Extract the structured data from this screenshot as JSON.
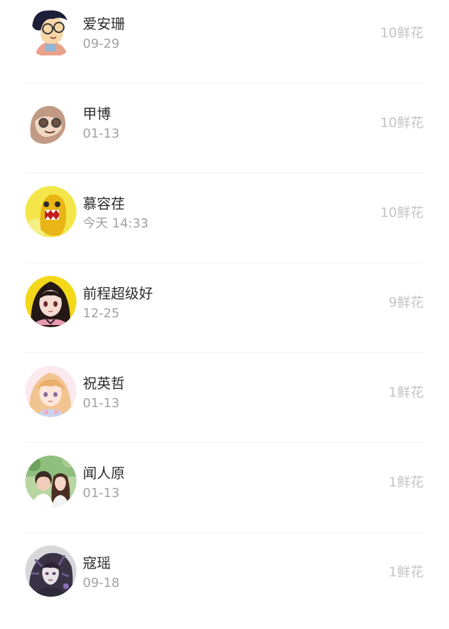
{
  "list": {
    "items": [
      {
        "name": "爱安珊",
        "date": "09-29",
        "flowers": "10鲜花",
        "avatar": "cartoon-boy-glasses-avatar-icon"
      },
      {
        "name": "甲博",
        "date": "01-13",
        "flowers": "10鲜花",
        "avatar": "cartoon-sloth-glasses-avatar-icon"
      },
      {
        "name": "慕容荏",
        "date": "今天 14:33",
        "flowers": "10鲜花",
        "avatar": "domo-character-avatar-icon"
      },
      {
        "name": "前程超级好",
        "date": "12-25",
        "flowers": "9鲜花",
        "avatar": "anime-girl-dark-hair-avatar-icon"
      },
      {
        "name": "祝英哲",
        "date": "01-13",
        "flowers": "1鲜花",
        "avatar": "anime-girl-blonde-avatar-icon"
      },
      {
        "name": "闻人原",
        "date": "01-13",
        "flowers": "1鲜花",
        "avatar": "couple-photo-avatar-icon"
      },
      {
        "name": "寇瑶",
        "date": "09-18",
        "flowers": "1鲜花",
        "avatar": "dark-anime-character-avatar-icon"
      }
    ]
  }
}
